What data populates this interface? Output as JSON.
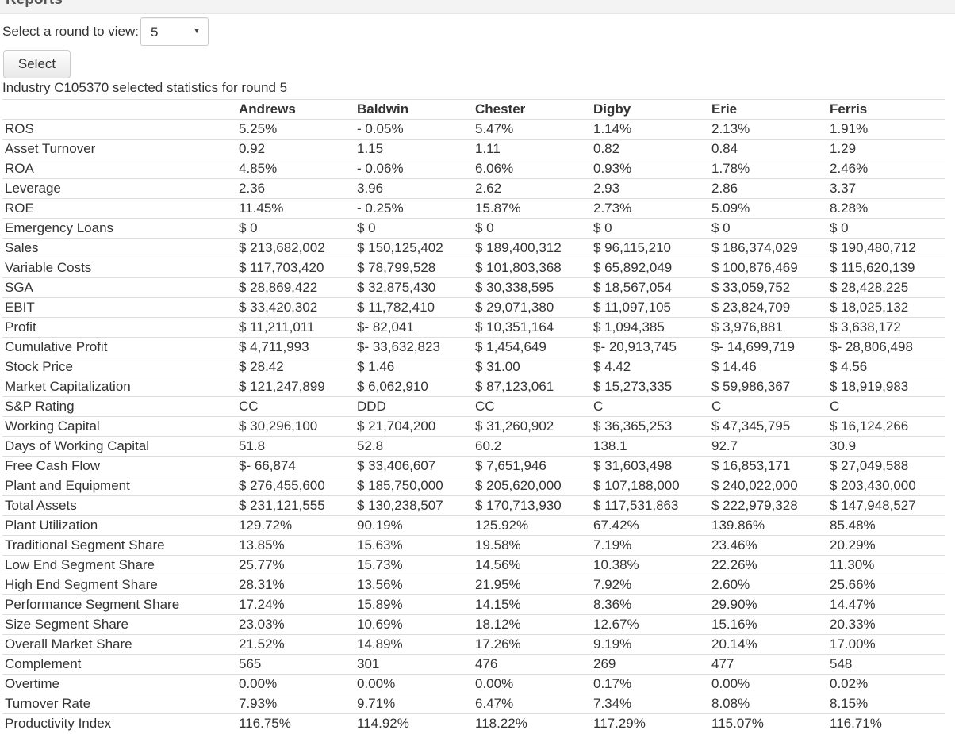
{
  "page": {
    "title": "Reports",
    "round_label": "Select a round to view:",
    "round_value": "5",
    "select_button": "Select",
    "caption": "Industry C105370 selected statistics for round 5"
  },
  "table": {
    "columns": [
      "",
      "Andrews",
      "Baldwin",
      "Chester",
      "Digby",
      "Erie",
      "Ferris"
    ],
    "rows": [
      [
        "ROS",
        "5.25%",
        "- 0.05%",
        "5.47%",
        "1.14%",
        "2.13%",
        "1.91%"
      ],
      [
        "Asset Turnover",
        "0.92",
        "1.15",
        "1.11",
        "0.82",
        "0.84",
        "1.29"
      ],
      [
        "ROA",
        "4.85%",
        "- 0.06%",
        "6.06%",
        "0.93%",
        "1.78%",
        "2.46%"
      ],
      [
        "Leverage",
        "2.36",
        "3.96",
        "2.62",
        "2.93",
        "2.86",
        "3.37"
      ],
      [
        "ROE",
        "11.45%",
        "- 0.25%",
        "15.87%",
        "2.73%",
        "5.09%",
        "8.28%"
      ],
      [
        "Emergency Loans",
        "$ 0",
        "$ 0",
        "$ 0",
        "$ 0",
        "$ 0",
        "$ 0"
      ],
      [
        "Sales",
        "$ 213,682,002",
        "$ 150,125,402",
        "$ 189,400,312",
        "$ 96,115,210",
        "$ 186,374,029",
        "$ 190,480,712"
      ],
      [
        "Variable Costs",
        "$ 117,703,420",
        "$ 78,799,528",
        "$ 101,803,368",
        "$ 65,892,049",
        "$ 100,876,469",
        "$ 115,620,139"
      ],
      [
        "SGA",
        "$ 28,869,422",
        "$ 32,875,430",
        "$ 30,338,595",
        "$ 18,567,054",
        "$ 33,059,752",
        "$ 28,428,225"
      ],
      [
        "EBIT",
        "$ 33,420,302",
        "$ 11,782,410",
        "$ 29,071,380",
        "$ 11,097,105",
        "$ 23,824,709",
        "$ 18,025,132"
      ],
      [
        "Profit",
        "$ 11,211,011",
        "$- 82,041",
        "$ 10,351,164",
        "$ 1,094,385",
        "$ 3,976,881",
        "$ 3,638,172"
      ],
      [
        "Cumulative Profit",
        "$ 4,711,993",
        "$- 33,632,823",
        "$ 1,454,649",
        "$- 20,913,745",
        "$- 14,699,719",
        "$- 28,806,498"
      ],
      [
        "Stock Price",
        "$ 28.42",
        "$ 1.46",
        "$ 31.00",
        "$ 4.42",
        "$ 14.46",
        "$ 4.56"
      ],
      [
        "Market Capitalization",
        "$ 121,247,899",
        "$ 6,062,910",
        "$ 87,123,061",
        "$ 15,273,335",
        "$ 59,986,367",
        "$ 18,919,983"
      ],
      [
        "S&P Rating",
        "CC",
        "DDD",
        "CC",
        "C",
        "C",
        "C"
      ],
      [
        "Working Capital",
        "$ 30,296,100",
        "$ 21,704,200",
        "$ 31,260,902",
        "$ 36,365,253",
        "$ 47,345,795",
        "$ 16,124,266"
      ],
      [
        "Days of Working Capital",
        "51.8",
        "52.8",
        "60.2",
        "138.1",
        "92.7",
        "30.9"
      ],
      [
        "Free Cash Flow",
        "$- 66,874",
        "$ 33,406,607",
        "$ 7,651,946",
        "$ 31,603,498",
        "$ 16,853,171",
        "$ 27,049,588"
      ],
      [
        "Plant and Equipment",
        "$ 276,455,600",
        "$ 185,750,000",
        "$ 205,620,000",
        "$ 107,188,000",
        "$ 240,022,000",
        "$ 203,430,000"
      ],
      [
        "Total Assets",
        "$ 231,121,555",
        "$ 130,238,507",
        "$ 170,713,930",
        "$ 117,531,863",
        "$ 222,979,328",
        "$ 147,948,527"
      ],
      [
        "Plant Utilization",
        "129.72%",
        "90.19%",
        "125.92%",
        "67.42%",
        "139.86%",
        "85.48%"
      ],
      [
        "Traditional Segment Share",
        "13.85%",
        "15.63%",
        "19.58%",
        "7.19%",
        "23.46%",
        "20.29%"
      ],
      [
        "Low End Segment Share",
        "25.77%",
        "15.73%",
        "14.56%",
        "10.38%",
        "22.26%",
        "11.30%"
      ],
      [
        "High End Segment Share",
        "28.31%",
        "13.56%",
        "21.95%",
        "7.92%",
        "2.60%",
        "25.66%"
      ],
      [
        "Performance Segment Share",
        "17.24%",
        "15.89%",
        "14.15%",
        "8.36%",
        "29.90%",
        "14.47%"
      ],
      [
        "Size Segment Share",
        "23.03%",
        "10.69%",
        "18.12%",
        "12.67%",
        "15.16%",
        "20.33%"
      ],
      [
        "Overall Market Share",
        "21.52%",
        "14.89%",
        "17.26%",
        "9.19%",
        "20.14%",
        "17.00%"
      ],
      [
        "Complement",
        "565",
        "301",
        "476",
        "269",
        "477",
        "548"
      ],
      [
        "Overtime",
        "0.00%",
        "0.00%",
        "0.00%",
        "0.17%",
        "0.00%",
        "0.02%"
      ],
      [
        "Turnover Rate",
        "7.93%",
        "9.71%",
        "6.47%",
        "7.34%",
        "8.08%",
        "8.15%"
      ],
      [
        "Productivity Index",
        "116.75%",
        "114.92%",
        "118.22%",
        "117.29%",
        "115.07%",
        "116.71%"
      ]
    ]
  },
  "icons": {
    "select_caret": "chevron-down-icon"
  }
}
